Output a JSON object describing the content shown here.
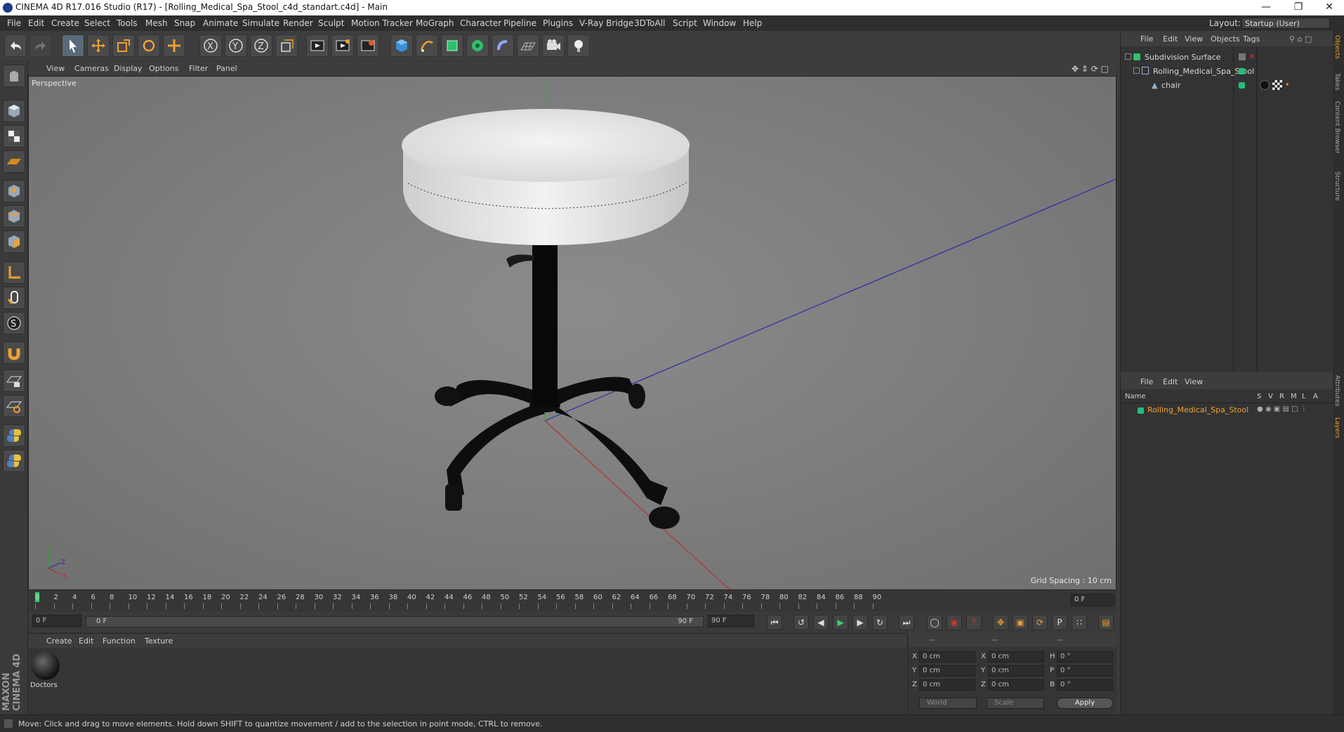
{
  "window": {
    "title": "CINEMA 4D R17.016 Studio (R17) - [Rolling_Medical_Spa_Stool_c4d_standart.c4d] - Main"
  },
  "menubar": {
    "items": [
      "File",
      "Edit",
      "Create",
      "Select",
      "Tools",
      "Mesh",
      "Snap",
      "Animate",
      "Simulate",
      "Render",
      "Sculpt",
      "Motion Tracker",
      "MoGraph",
      "Character",
      "Pipeline",
      "Plugins",
      "V-Ray Bridge",
      "3DToAll",
      "Script",
      "Window",
      "Help"
    ],
    "layout_label": "Layout:",
    "layout_value": "Startup (User)"
  },
  "viewport": {
    "menu": [
      "View",
      "Cameras",
      "Display",
      "Options",
      "Filter",
      "Panel"
    ],
    "label": "Perspective",
    "grid_spacing": "Grid Spacing : 10 cm"
  },
  "timeline": {
    "ticks": [
      "0",
      "2",
      "4",
      "6",
      "8",
      "10",
      "12",
      "14",
      "16",
      "18",
      "20",
      "22",
      "24",
      "26",
      "28",
      "30",
      "32",
      "34",
      "36",
      "38",
      "40",
      "42",
      "44",
      "46",
      "48",
      "50",
      "52",
      "54",
      "56",
      "58",
      "60",
      "62",
      "64",
      "66",
      "68",
      "70",
      "72",
      "74",
      "76",
      "78",
      "80",
      "82",
      "84",
      "86",
      "88",
      "90"
    ],
    "current_frame": "0 F"
  },
  "playbar": {
    "start": "0 F",
    "range_start": "0 F",
    "range_end": "90 F",
    "end": "90 F"
  },
  "materials": {
    "menu": [
      "Create",
      "Edit",
      "Function",
      "Texture"
    ],
    "items": [
      {
        "name": "Doctors"
      }
    ]
  },
  "coords": {
    "rows": [
      {
        "a": "X",
        "av": "0 cm",
        "b": "X",
        "bv": "0 cm",
        "c": "H",
        "cv": "0 °"
      },
      {
        "a": "Y",
        "av": "0 cm",
        "b": "Y",
        "bv": "0 cm",
        "c": "P",
        "cv": "0 °"
      },
      {
        "a": "Z",
        "av": "0 cm",
        "b": "Z",
        "bv": "0 cm",
        "c": "B",
        "cv": "0 °"
      }
    ],
    "mode_world": "World",
    "mode_scale": "Scale",
    "apply": "Apply",
    "header_dashes": [
      "--",
      "--",
      "--"
    ]
  },
  "objects": {
    "menu": [
      "File",
      "Edit",
      "View",
      "Objects",
      "Tags"
    ],
    "items": [
      {
        "name": "Subdivision Surface",
        "indent": 0
      },
      {
        "name": "Rolling_Medical_Spa_Stool",
        "indent": 1
      },
      {
        "name": "chair",
        "indent": 2
      }
    ]
  },
  "layers": {
    "menu": [
      "File",
      "Edit",
      "View"
    ],
    "headers": {
      "name": "Name",
      "s": "S",
      "v": "V",
      "r": "R",
      "m": "M",
      "l": "L",
      "a": "A"
    },
    "items": [
      {
        "name": "Rolling_Medical_Spa_Stool"
      }
    ]
  },
  "right_tabs": [
    "Objects",
    "Takes",
    "Content Browser",
    "Structure",
    "Attributes",
    "Layers"
  ],
  "status": {
    "text": "Move: Click and drag to move elements. Hold down SHIFT to quantize movement / add to the selection in point mode, CTRL to remove."
  },
  "brand": {
    "vertical": "MAXON CINEMA 4D"
  },
  "colors": {
    "accent_orange": "#f0a030",
    "layer_green": "#22c07a",
    "timeline_marker": "#2bd16a"
  }
}
